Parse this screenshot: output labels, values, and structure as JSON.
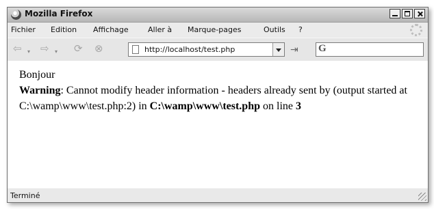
{
  "window": {
    "title": "Mozilla Firefox"
  },
  "menubar": {
    "items": [
      {
        "label": "Fichier"
      },
      {
        "label": "Edition"
      },
      {
        "label": "Affichage"
      },
      {
        "label": "Aller à"
      },
      {
        "label": "Marque-pages"
      },
      {
        "label": "Outils"
      },
      {
        "label": "?"
      }
    ]
  },
  "navbar": {
    "url": "http://localhost/test.php",
    "search_engine": "G"
  },
  "content": {
    "line1": "Bonjour",
    "warning_label": "Warning",
    "warning_text1": ": Cannot modify header information - headers already sent by (output started at C:\\wamp\\www\\test.php:2) in ",
    "file_path": "C:\\wamp\\www\\test.php",
    "warning_text2": " on line ",
    "line_number": "3"
  },
  "statusbar": {
    "text": "Terminé"
  },
  "icons": {
    "app": "firefox-logo-icon",
    "back": "back-arrow-icon",
    "forward": "forward-arrow-icon",
    "reload": "reload-icon",
    "stop": "stop-icon",
    "page": "page-icon",
    "go": "go-icon",
    "search": "google-search-icon",
    "throbber": "throbber-icon"
  }
}
